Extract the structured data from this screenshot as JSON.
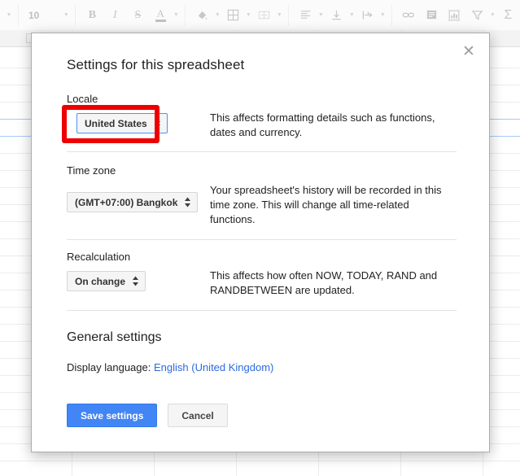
{
  "toolbar": {
    "font_size": "10",
    "buttons": [
      {
        "name": "bold",
        "glyph": "B"
      },
      {
        "name": "italic",
        "glyph": "I"
      },
      {
        "name": "strikethrough",
        "glyph": "S"
      },
      {
        "name": "text-color",
        "glyph": "A"
      },
      {
        "name": "fill-color",
        "glyph": "◢"
      },
      {
        "name": "borders",
        "glyph": "⊞"
      },
      {
        "name": "merge-cells",
        "glyph": "⧉"
      },
      {
        "name": "horizontal-align",
        "glyph": "≡"
      },
      {
        "name": "vertical-align",
        "glyph": "↓"
      },
      {
        "name": "text-wrapping",
        "glyph": "↦"
      },
      {
        "name": "insert-link",
        "glyph": "∞"
      },
      {
        "name": "insert-comment",
        "glyph": "▤"
      },
      {
        "name": "insert-chart",
        "glyph": "Ὄa"
      },
      {
        "name": "create-filter",
        "glyph": "▽"
      },
      {
        "name": "functions",
        "glyph": "Σ"
      }
    ]
  },
  "dialog": {
    "title": "Settings for this spreadsheet",
    "close_label": "✕",
    "locale": {
      "label": "Locale",
      "value": "United States",
      "description": "This affects formatting details such as functions, dates and currency."
    },
    "timezone": {
      "label": "Time zone",
      "value": "(GMT+07:00) Bangkok",
      "description": "Your spreadsheet's history will be recorded in this time zone. This will change all time-related functions."
    },
    "recalculation": {
      "label": "Recalculation",
      "value": "On change",
      "description": "This affects how often NOW, TODAY, RAND and RANDBETWEEN are updated."
    },
    "general": {
      "title": "General settings",
      "display_language_label": "Display language:",
      "display_language_value": "English (United Kingdom)"
    },
    "actions": {
      "save_label": "Save settings",
      "cancel_label": "Cancel"
    },
    "select_arrows": "↕"
  },
  "colors": {
    "highlight_box": "#ee0000",
    "primary_button": "#4285f4",
    "link": "#2a6ae0",
    "focus_border": "#4d90fe"
  }
}
